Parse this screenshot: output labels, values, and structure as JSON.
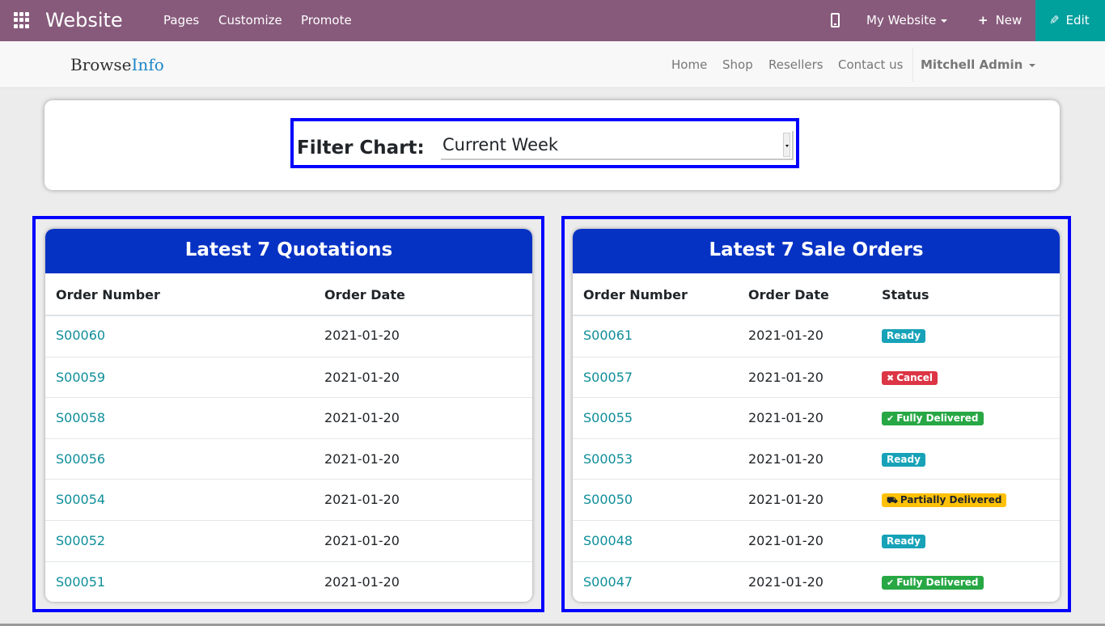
{
  "admin_bar": {
    "brand": "Website",
    "menu": [
      "Pages",
      "Customize",
      "Promote"
    ],
    "site_selector": "My Website",
    "new_label": "New",
    "edit_label": "Edit",
    "colors": {
      "bar": "#875a7b",
      "edit": "#00a09d"
    }
  },
  "site_header": {
    "logo_part1": "Browse",
    "logo_part2": "Info",
    "nav": [
      "Home",
      "Shop",
      "Resellers",
      "Contact us"
    ],
    "user": "Mitchell Admin"
  },
  "filter": {
    "label": "Filter Chart:",
    "selected": "Current Week"
  },
  "quotations": {
    "title": "Latest 7 Quotations",
    "columns": [
      "Order Number",
      "Order Date"
    ],
    "rows": [
      {
        "order": "S00060",
        "date": "2021-01-20"
      },
      {
        "order": "S00059",
        "date": "2021-01-20"
      },
      {
        "order": "S00058",
        "date": "2021-01-20"
      },
      {
        "order": "S00056",
        "date": "2021-01-20"
      },
      {
        "order": "S00054",
        "date": "2021-01-20"
      },
      {
        "order": "S00052",
        "date": "2021-01-20"
      },
      {
        "order": "S00051",
        "date": "2021-01-20"
      }
    ]
  },
  "sale_orders": {
    "title": "Latest 7 Sale Orders",
    "columns": [
      "Order Number",
      "Order Date",
      "Status"
    ],
    "rows": [
      {
        "order": "S00061",
        "date": "2021-01-20",
        "status": "Ready",
        "status_type": "ready"
      },
      {
        "order": "S00057",
        "date": "2021-01-20",
        "status": "Cancel",
        "status_type": "cancel"
      },
      {
        "order": "S00055",
        "date": "2021-01-20",
        "status": "Fully Delivered",
        "status_type": "delivered"
      },
      {
        "order": "S00053",
        "date": "2021-01-20",
        "status": "Ready",
        "status_type": "ready"
      },
      {
        "order": "S00050",
        "date": "2021-01-20",
        "status": "Partially Delivered",
        "status_type": "partial"
      },
      {
        "order": "S00048",
        "date": "2021-01-20",
        "status": "Ready",
        "status_type": "ready"
      },
      {
        "order": "S00047",
        "date": "2021-01-20",
        "status": "Fully Delivered",
        "status_type": "delivered"
      }
    ]
  },
  "colors": {
    "card_header": "#0632c4",
    "highlight_border": "#0000ff",
    "link": "#0e8e99"
  }
}
